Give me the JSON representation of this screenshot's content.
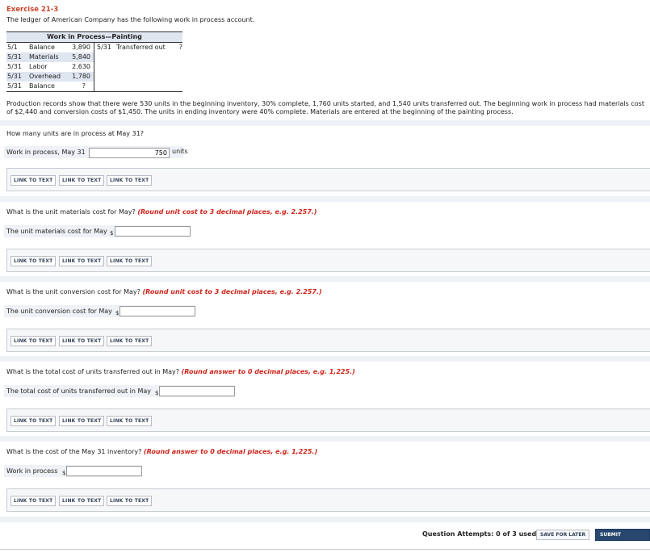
{
  "exercise_title": "Exercise 21-3",
  "intro": "The ledger of American Company has the following work in process account.",
  "t_account": {
    "title": "Work in Process—Painting",
    "debits": [
      {
        "date": "5/1",
        "label": "Balance",
        "amount": "3,890"
      },
      {
        "date": "5/31",
        "label": "Materials",
        "amount": "5,840"
      },
      {
        "date": "5/31",
        "label": "Labor",
        "amount": "2,630"
      },
      {
        "date": "5/31",
        "label": "Overhead",
        "amount": "1,780"
      },
      {
        "date": "5/31",
        "label": "Balance",
        "amount": "?"
      }
    ],
    "credits": [
      {
        "date": "5/31",
        "label": "Transferred out",
        "amount": "?"
      }
    ]
  },
  "production_text": "Production records show that there were 530 units in the beginning inventory, 30% complete, 1,760 units started, and 1,540 units transferred out. The beginning work in process had materials cost of $2,440 and conversion costs of $1,450. The units in ending inventory were 40% complete. Materials are entered at the beginning of the painting process.",
  "link_labels": [
    "LINK TO TEXT",
    "LINK TO TEXT",
    "LINK TO TEXT"
  ],
  "currency": "$",
  "questions": [
    {
      "question": "How many units are in process at May 31?",
      "round": "",
      "field_label": "Work in process, May 31",
      "value": "750",
      "unit": "units"
    },
    {
      "question": "What is the unit materials cost for May?",
      "round": "(Round unit cost to 3 decimal places, e.g. 2.257.)",
      "field_label": "The unit materials cost for May",
      "value": ""
    },
    {
      "question": "What is the unit conversion cost for May?",
      "round": "(Round unit cost to 3 decimal places, e.g. 2.257.)",
      "field_label": "The unit conversion cost for May",
      "value": ""
    },
    {
      "question": "What is the total cost of units transferred out in May?",
      "round": "(Round answer to 0 decimal places, e.g. 1,225.)",
      "field_label": "The total cost of units transferred out in May",
      "value": ""
    },
    {
      "question": "What is the cost of the May 31 inventory?",
      "round": "(Round answer to 0 decimal places, e.g. 1,225.)",
      "field_label": "Work in process",
      "value": ""
    }
  ],
  "footer": {
    "attempts": "Question Attempts: 0 of 3 used",
    "save_later": "SAVE FOR LATER",
    "submit": "SUBMIT ANSWER"
  }
}
